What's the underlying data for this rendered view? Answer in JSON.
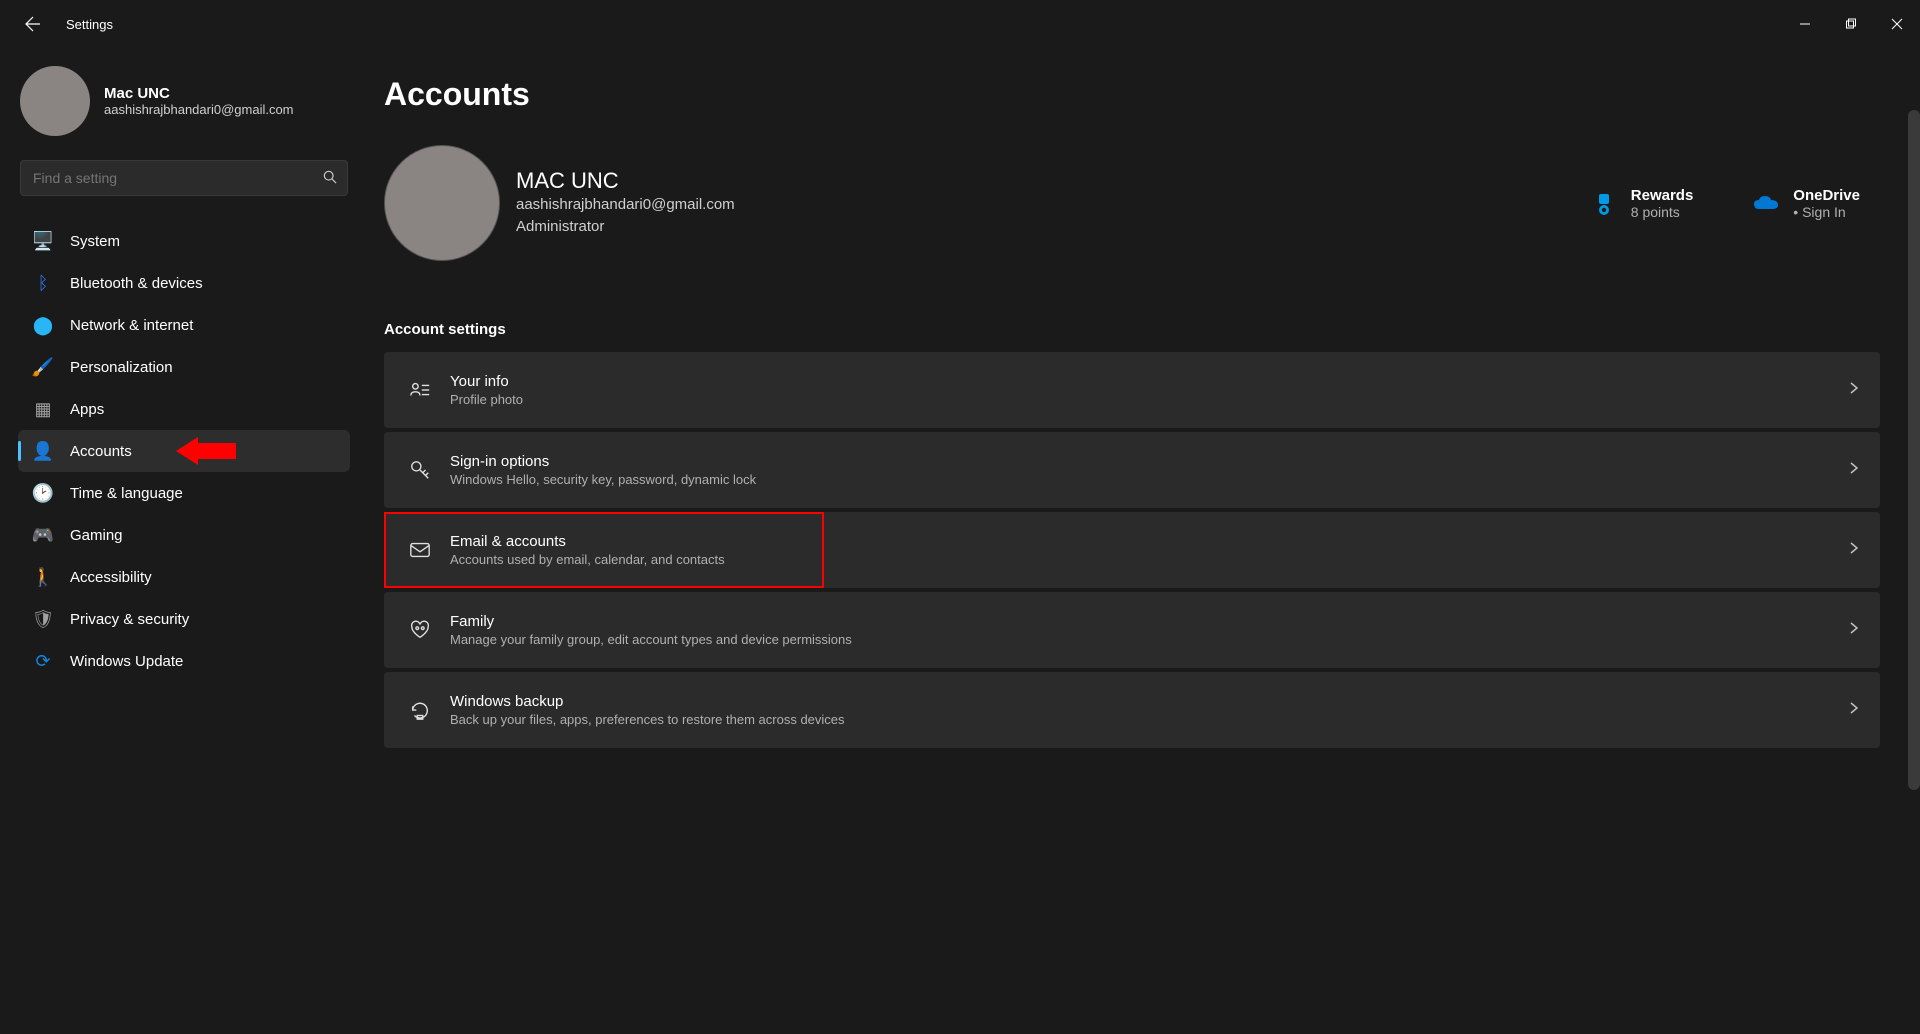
{
  "app_title": "Settings",
  "user": {
    "name": "Mac UNC",
    "email": "aashishrajbhandari0@gmail.com"
  },
  "search": {
    "placeholder": "Find a setting"
  },
  "nav": [
    {
      "key": "system",
      "label": "System",
      "icon": "🖥️",
      "iconColor": "#4cc2ff"
    },
    {
      "key": "bluetooth",
      "label": "Bluetooth & devices",
      "icon": "ᛒ",
      "iconColor": "#2e7cf6"
    },
    {
      "key": "network",
      "label": "Network & internet",
      "icon": "⬤",
      "iconColor": "#29b6f6"
    },
    {
      "key": "personalization",
      "label": "Personalization",
      "icon": "🖌️",
      "iconColor": ""
    },
    {
      "key": "apps",
      "label": "Apps",
      "icon": "▦",
      "iconColor": "#a0a0a0"
    },
    {
      "key": "accounts",
      "label": "Accounts",
      "icon": "👤",
      "iconColor": "#2bb673",
      "active": true
    },
    {
      "key": "time",
      "label": "Time & language",
      "icon": "🕑",
      "iconColor": ""
    },
    {
      "key": "gaming",
      "label": "Gaming",
      "icon": "🎮",
      "iconColor": "#a0a0a0"
    },
    {
      "key": "accessibility",
      "label": "Accessibility",
      "icon": "🚶",
      "iconColor": "#29b6f6"
    },
    {
      "key": "privacy",
      "label": "Privacy & security",
      "icon": "🛡",
      "iconColor": "#a0a0a0"
    },
    {
      "key": "update",
      "label": "Windows Update",
      "icon": "⟳",
      "iconColor": "#0d8ae6"
    }
  ],
  "page": {
    "heading": "Accounts",
    "profile": {
      "name": "MAC UNC",
      "email": "aashishrajbhandari0@gmail.com",
      "role": "Administrator"
    },
    "widgets": {
      "rewards": {
        "title": "Rewards",
        "sub": "8 points"
      },
      "onedrive": {
        "title": "OneDrive",
        "sub": "Sign In"
      }
    },
    "section_title": "Account settings",
    "rows": [
      {
        "key": "yourinfo",
        "title": "Your info",
        "desc": "Profile photo"
      },
      {
        "key": "signin",
        "title": "Sign-in options",
        "desc": "Windows Hello, security key, password, dynamic lock"
      },
      {
        "key": "email",
        "title": "Email & accounts",
        "desc": "Accounts used by email, calendar, and contacts",
        "highlight": true
      },
      {
        "key": "family",
        "title": "Family",
        "desc": "Manage your family group, edit account types and device permissions"
      },
      {
        "key": "backup",
        "title": "Windows backup",
        "desc": "Back up your files, apps, preferences to restore them across devices"
      }
    ]
  }
}
